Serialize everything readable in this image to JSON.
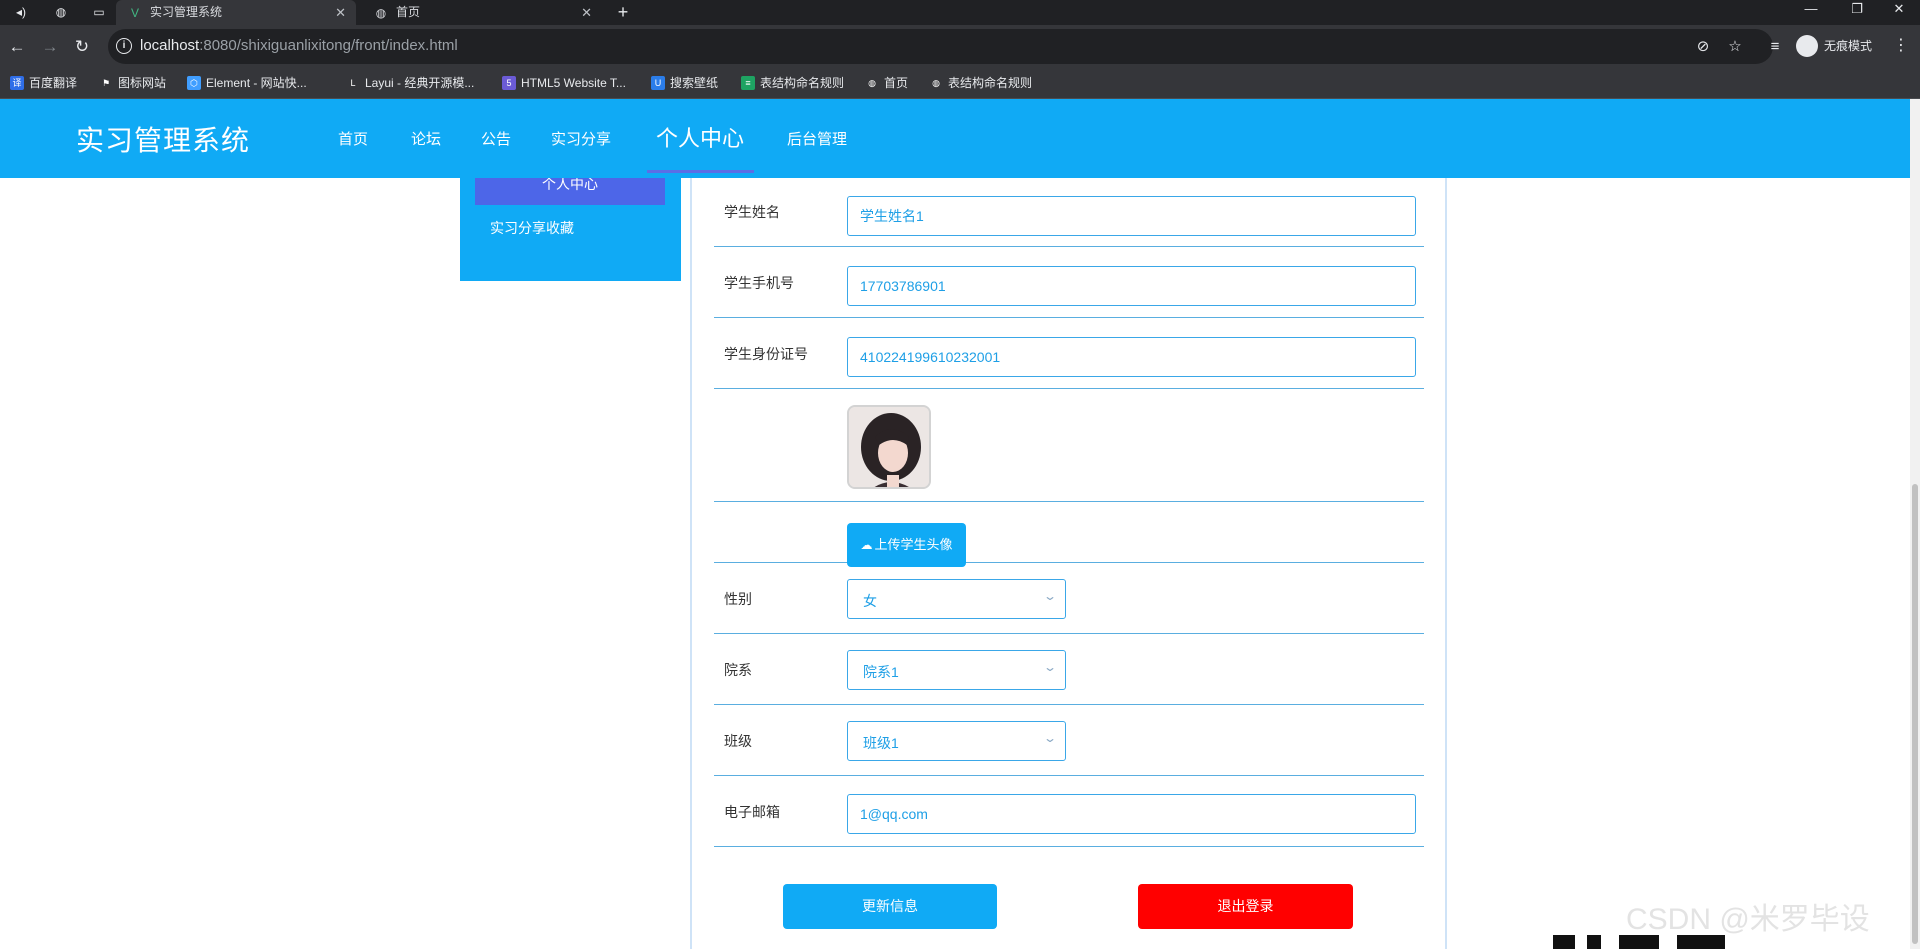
{
  "browser": {
    "tabs": [
      {
        "title": "实习管理系统",
        "active": true
      },
      {
        "title": "首页",
        "active": false
      }
    ],
    "url_host": "localhost",
    "url_rest": ":8080/shixiguanlixitong/front/index.html",
    "profile_label": "无痕模式",
    "bookmarks": [
      {
        "label": "百度翻译",
        "icon": "baidu-translate-icon",
        "color": "#2f6ee8"
      },
      {
        "label": "图标网站",
        "icon": "flag-icon",
        "color": "#35363a"
      },
      {
        "label": "Element - 网站快...",
        "icon": "element-icon",
        "color": "#409eff"
      },
      {
        "label": "Layui - 经典开源模...",
        "icon": "layui-icon",
        "color": "#35363a"
      },
      {
        "label": "HTML5 Website T...",
        "icon": "html5-icon",
        "color": "#6b5bd6"
      },
      {
        "label": "搜索壁纸",
        "icon": "wallpaper-icon",
        "color": "#2b7de9"
      },
      {
        "label": "表结构命名规则",
        "icon": "sheet-icon",
        "color": "#1ea362"
      },
      {
        "label": "首页",
        "icon": "globe-icon",
        "color": "#35363a"
      },
      {
        "label": "表结构命名规则",
        "icon": "globe-icon",
        "color": "#35363a"
      }
    ]
  },
  "site": {
    "brand": "实习管理系统",
    "nav": [
      "首页",
      "论坛",
      "公告",
      "实习分享",
      "个人中心",
      "后台管理"
    ],
    "active_nav": "个人中心",
    "colors": {
      "primary": "#10aaf5",
      "accent": "#4d66e8",
      "danger": "#ff0000",
      "text_blue": "#1e9fe6"
    }
  },
  "sidebar": {
    "active_item": "个人中心",
    "items": [
      "实习分享收藏"
    ]
  },
  "form": {
    "student_name": {
      "label": "学生姓名",
      "value": "学生姓名1"
    },
    "student_phone": {
      "label": "学生手机号",
      "value": "17703786901"
    },
    "student_id": {
      "label": "学生身份证号",
      "value": "410224199610232001"
    },
    "upload_label": "上传学生头像",
    "gender": {
      "label": "性别",
      "value": "女"
    },
    "department": {
      "label": "院系",
      "value": "院系1"
    },
    "class": {
      "label": "班级",
      "value": "班级1"
    },
    "email": {
      "label": "电子邮箱",
      "value": "1@qq.com"
    }
  },
  "actions": {
    "update": "更新信息",
    "logout": "退出登录"
  },
  "watermark": "CSDN @米罗毕设"
}
